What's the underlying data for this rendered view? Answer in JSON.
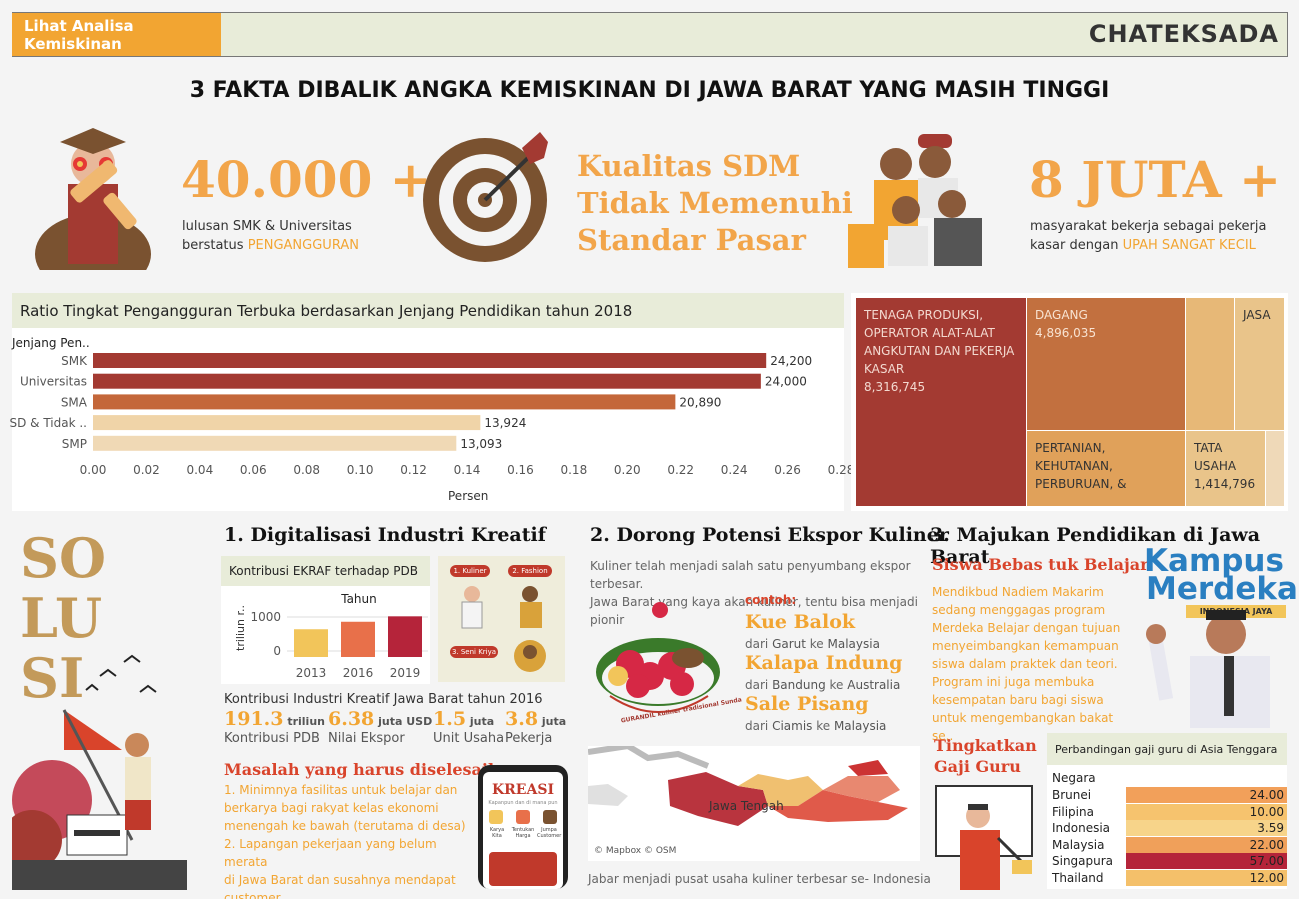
{
  "header": {
    "nav_button": "Lihat Analisa Kemiskinan",
    "brand": "CHATEKSADA",
    "title": "3 FAKTA DIBALIK ANGKA KEMISKINAN DI JAWA BARAT YANG MASIH TINGGI"
  },
  "facts": {
    "fact1": {
      "number": "40.000 +",
      "desc_line1": "lulusan SMK & Universitas",
      "desc_line2_prefix": "berstatus ",
      "desc_highlight": "PENGANGGURAN"
    },
    "fact2": {
      "line1": "Kualitas SDM",
      "line2": "Tidak Memenuhi",
      "line3": "Standar Pasar"
    },
    "fact3": {
      "number": "8 JUTA +",
      "desc_line1": "masyarakat bekerja sebagai pekerja",
      "desc_line2_prefix": "kasar dengan ",
      "desc_highlight": "UPAH SANGAT KECIL"
    }
  },
  "unemployment_chart": {
    "title": "Ratio Tingkat Pengangguran Terbuka berdasarkan Jenjang Pendidikan tahun 2018",
    "row_header": "Jenjang Pen..",
    "x_axis_label": "Persen",
    "ticks": [
      "0.00",
      "0.02",
      "0.04",
      "0.06",
      "0.08",
      "0.10",
      "0.12",
      "0.14",
      "0.16",
      "0.18",
      "0.20",
      "0.22",
      "0.24",
      "0.26",
      "0.28"
    ]
  },
  "chart_data": [
    {
      "type": "bar",
      "title": "Ratio Tingkat Pengangguran Terbuka berdasarkan Jenjang Pendidikan tahun 2018",
      "categories": [
        "SMK",
        "Universitas",
        "SMA",
        "SD & Tidak ..",
        "SMP"
      ],
      "values": [
        0.252,
        0.25,
        0.218,
        0.145,
        0.136
      ],
      "labels": [
        "24,200",
        "24,000",
        "20,890",
        "13,924",
        "13,093"
      ],
      "colors": [
        "#a33a32",
        "#a33a32",
        "#c4673a",
        "#f0d4a8",
        "#f0d9b5"
      ],
      "xlabel": "Persen",
      "ylabel": "Jenjang Pen..",
      "xlim": [
        0,
        0.28
      ],
      "grid": false
    },
    {
      "type": "bar",
      "title": "Kontribusi EKRAF terhadap PDB",
      "categories": [
        "2013",
        "2016",
        "2019"
      ],
      "values": [
        640,
        860,
        1020
      ],
      "colors": [
        "#f2c55a",
        "#e8704a",
        "#b5243a"
      ],
      "xlabel": "",
      "ylabel": "triliun r..",
      "series_header": "Tahun",
      "yticks": [
        "0",
        "1000"
      ],
      "ylim": [
        0,
        1250
      ]
    },
    {
      "type": "table",
      "title": "Perbandingan gaji guru di Asia Tenggara",
      "header": "Negara",
      "categories": [
        "Brunei",
        "Filipina",
        "Indonesia",
        "Malaysia",
        "Singapura",
        "Thailand"
      ],
      "values": [
        24.0,
        10.0,
        3.59,
        22.0,
        57.0,
        12.0
      ],
      "labels": [
        "24.00",
        "10.00",
        "3.59",
        "22.00",
        "57.00",
        "12.00"
      ],
      "colors": [
        "#f2a05a",
        "#f6c36e",
        "#f7d48a",
        "#f0a05a",
        "#b5243a",
        "#f4c06a"
      ]
    }
  ],
  "treemap": {
    "cells": [
      {
        "lines": [
          "TENAGA PRODUKSI,",
          "OPERATOR ALAT-ALAT",
          "ANGKUTAN DAN PEKERJA",
          "KASAR",
          "8,316,745"
        ],
        "color": "#a33a32",
        "text_color": "#f3d9d0"
      },
      {
        "lines": [
          "DAGANG",
          "4,896,035"
        ],
        "color": "#c2703f",
        "text_color": "#f8e3d2"
      },
      {
        "lines": [
          ""
        ],
        "color": "#e7b877",
        "text_color": "#333"
      },
      {
        "lines": [
          "JASA"
        ],
        "color": "#e9c48a",
        "text_color": "#333"
      },
      {
        "lines": [
          "PERTANIAN,",
          "KEHUTANAN,",
          "PERBURUAN, &"
        ],
        "color": "#e0a15a",
        "text_color": "#333"
      },
      {
        "lines": [
          "TATA",
          "USAHA",
          "1,414,796"
        ],
        "color": "#e9c48a",
        "text_color": "#333"
      },
      {
        "lines": [
          ""
        ],
        "color": "#efd9b8",
        "text_color": "#333"
      }
    ]
  },
  "solusi_letters": [
    "SO",
    "LU",
    "SI"
  ],
  "solution1": {
    "title": "1. Digitalisasi Industri Kreatif",
    "chart_head": "Kontribusi EKRAF terhadap PDB",
    "tags": [
      "1. Kuliner",
      "2. Fashion",
      "3. Seni Kriya"
    ],
    "stats_title": "Kontribusi Industri Kreatif Jawa Barat tahun 2016",
    "stats": [
      {
        "num": "191.3",
        "unit": "triliun",
        "cap": "Kontribusi PDB"
      },
      {
        "num": "6.38",
        "unit": "juta USD",
        "cap": "Nilai Ekspor"
      },
      {
        "num": "1.5",
        "unit": "juta",
        "cap": "Unit Usaha"
      },
      {
        "num": "3.8",
        "unit": "juta",
        "cap": "Pekerja"
      }
    ],
    "problem_title": "Masalah yang harus diselesaikan:",
    "problems": [
      "1. Minimnya fasilitas untuk belajar dan",
      "berkarya bagi rakyat kelas ekonomi",
      "menengah ke bawah (terutama di desa)",
      "2. Lapangan pekerjaan yang belum merata",
      "di Jawa Barat  dan susahnya mendapat",
      "customer"
    ],
    "phone_brand": "KREASI",
    "phone_sub": "Kapanpun dan di mana pun",
    "phone_items": [
      "Karya Kita",
      "Tentukan Harga",
      "Jumpa Customer"
    ]
  },
  "solution2": {
    "title": "2. Dorong Potensi Ekspor Kuliner",
    "intro_line1": "Kuliner telah menjadi salah satu penyumbang ekspor terbesar.",
    "intro_line2": "Jawa Barat yang kaya akan kuliner,  tentu bisa menjadi pionir",
    "contoh": "contoh:",
    "food_caption": "GURANDIL kuliner tradisional Sunda",
    "foods": [
      {
        "name": "Kue Balok",
        "from": "Garut",
        "to": "Malaysia"
      },
      {
        "name": "Kalapa Indung",
        "from": "Bandung",
        "to": "Australia"
      },
      {
        "name": "Sale Pisang",
        "from": "Ciamis",
        "to": "Malaysia"
      }
    ],
    "route_from": "dari",
    "route_to": "ke",
    "map_label": "Jawa Tengah",
    "map_credit": "© Mapbox © OSM",
    "footer": "Jabar menjadi pusat usaha kuliner terbesar se- Indonesia"
  },
  "solution3": {
    "title": "3. Majukan Pendidikan di Jawa Barat",
    "subtitle": "Siswa Bebas tuk Belajar",
    "body": [
      "Mendikbud Nadiem Makarim",
      "sedang menggagas program",
      "Merdeka Belajar dengan tujuan",
      "menyeimbangkan kemampuan",
      "siswa dalam praktek dan teori.",
      "Program ini juga membuka",
      "kesempatan baru bagi siswa",
      "untuk mengembangkan bakat se.."
    ],
    "logo_line1": "Kampus",
    "logo_line2": "Merdeka",
    "logo_line3": "INDONESIA JAYA",
    "salary_title_line1": "Tingkatkan",
    "salary_title_line2": "Gaji Guru",
    "table_title": "Perbandingan gaji guru di Asia Tenggara",
    "table_header": "Negara"
  }
}
